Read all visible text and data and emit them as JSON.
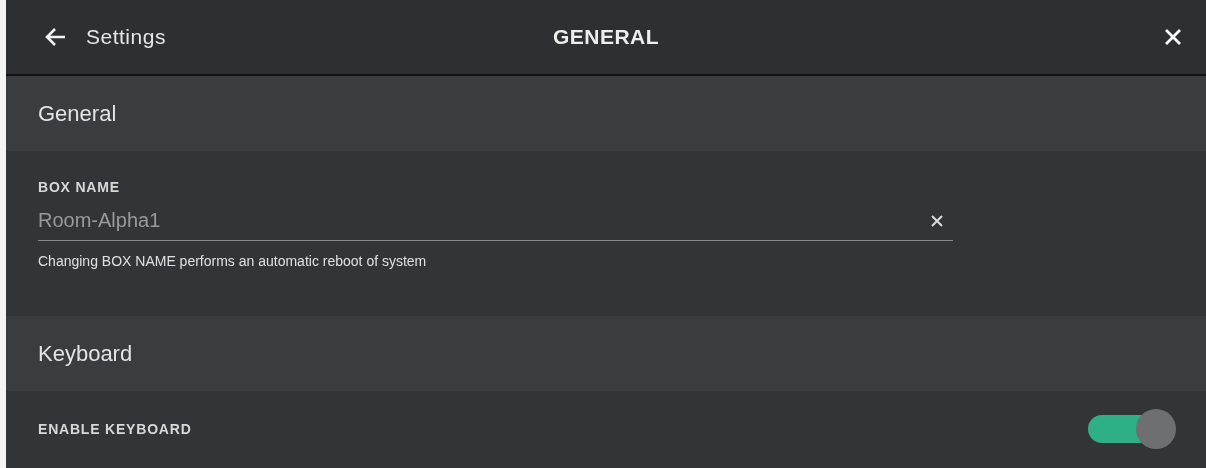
{
  "header": {
    "back_label": "Settings",
    "title": "GENERAL"
  },
  "sections": [
    {
      "title": "General",
      "items": [
        {
          "kind": "text",
          "label": "BOX NAME",
          "value": "Room-Alpha1",
          "hint": "Changing BOX NAME performs an automatic reboot of system"
        }
      ]
    },
    {
      "title": "Keyboard",
      "items": [
        {
          "kind": "toggle",
          "label": "ENABLE KEYBOARD",
          "on": true
        }
      ]
    }
  ]
}
